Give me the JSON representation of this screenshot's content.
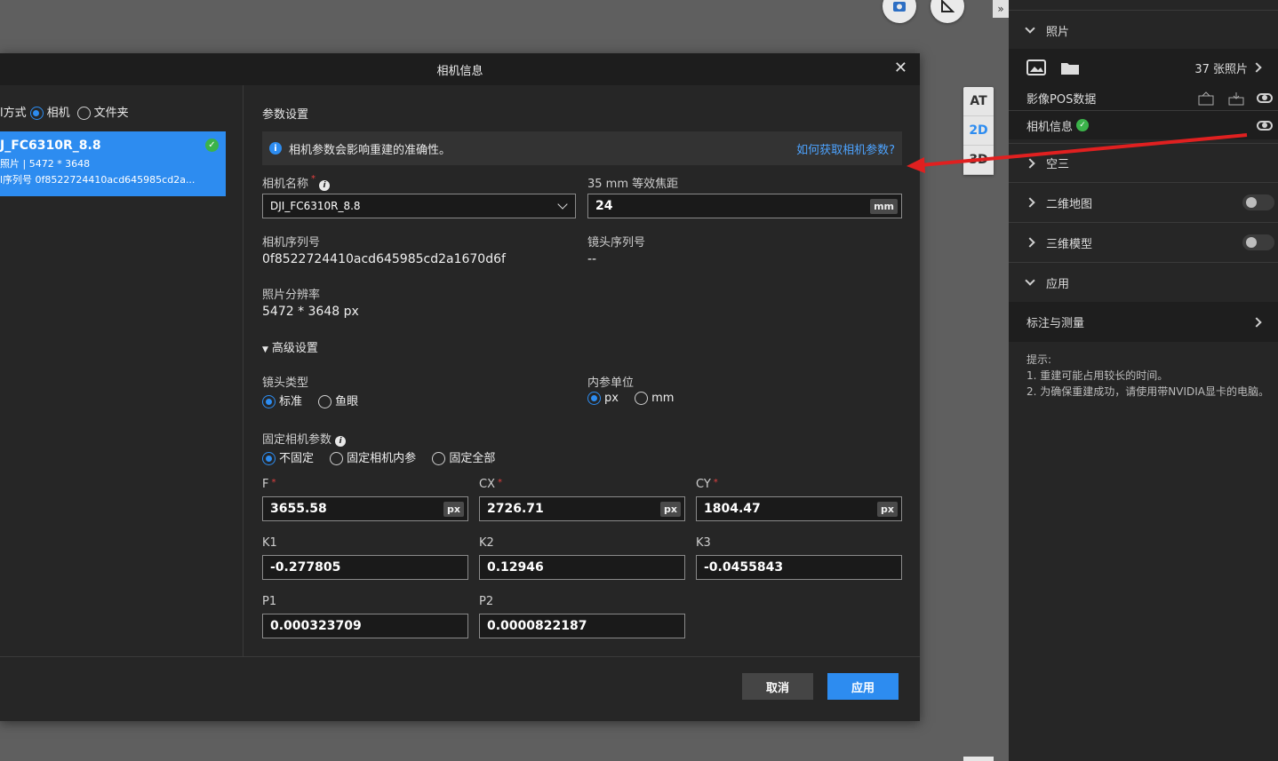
{
  "dialog": {
    "title": "相机信息",
    "close": "✕",
    "import_mode_label": "l方式",
    "import_options": [
      "相机",
      "文件夹"
    ],
    "camera_card": {
      "name": "J_FC6310R_8.8",
      "line2": "照片 | 5472 * 3648",
      "line3": "l序列号 0f8522724410acd645985cd2a..."
    },
    "section_title": "参数设置",
    "notice": {
      "text": "相机参数会影响重建的准确性。",
      "link": "如何获取相机参数?"
    },
    "camera_name_label": "相机名称",
    "camera_name_value": "DJI_FC6310R_8.8",
    "focal_label": "35 mm 等效焦距",
    "focal_value": "24",
    "focal_unit": "mm",
    "serial_label": "相机序列号",
    "serial_value": "0f8522724410acd645985cd2a1670d6f",
    "lens_serial_label": "镜头序列号",
    "lens_serial_value": "--",
    "resolution_label": "照片分辨率",
    "resolution_value": "5472 * 3648 px",
    "advanced_label": "高级设置",
    "lens_type_label": "镜头类型",
    "lens_type_options": [
      "标准",
      "鱼眼"
    ],
    "intrinsic_unit_label": "内参单位",
    "intrinsic_unit_options": [
      "px",
      "mm"
    ],
    "fix_label": "固定相机参数",
    "fix_options": [
      "不固定",
      "固定相机内参",
      "固定全部"
    ],
    "params": {
      "F": {
        "label": "F",
        "value": "3655.58",
        "unit": "px"
      },
      "CX": {
        "label": "CX",
        "value": "2726.71",
        "unit": "px"
      },
      "CY": {
        "label": "CY",
        "value": "1804.47",
        "unit": "px"
      },
      "K1": {
        "label": "K1",
        "value": "-0.277805"
      },
      "K2": {
        "label": "K2",
        "value": "0.12946"
      },
      "K3": {
        "label": "K3",
        "value": "-0.0455843"
      },
      "P1": {
        "label": "P1",
        "value": "0.000323709"
      },
      "P2": {
        "label": "P2",
        "value": "0.0000822187"
      }
    },
    "cancel": "取消",
    "apply": "应用"
  },
  "view_switch": [
    "AT",
    "2D",
    "3D"
  ],
  "collapse": "»",
  "right_panel": {
    "photos_header": "照片",
    "photo_count": "37 张照片",
    "pos_label": "影像POS数据",
    "camera_info_label": "相机信息",
    "sections": [
      "空三",
      "二维地图",
      "三维模型"
    ],
    "app_header": "应用",
    "annotation": "标注与测量",
    "tips_title": "提示:",
    "tip1": "1. 重建可能占用较长的时间。",
    "tip2": "2. 为确保重建成功，请使用带NVIDIA显卡的电脑。"
  },
  "colors": {
    "accent": "#2d8cf0",
    "arrow": "#e02020",
    "success": "#3bb34a"
  }
}
